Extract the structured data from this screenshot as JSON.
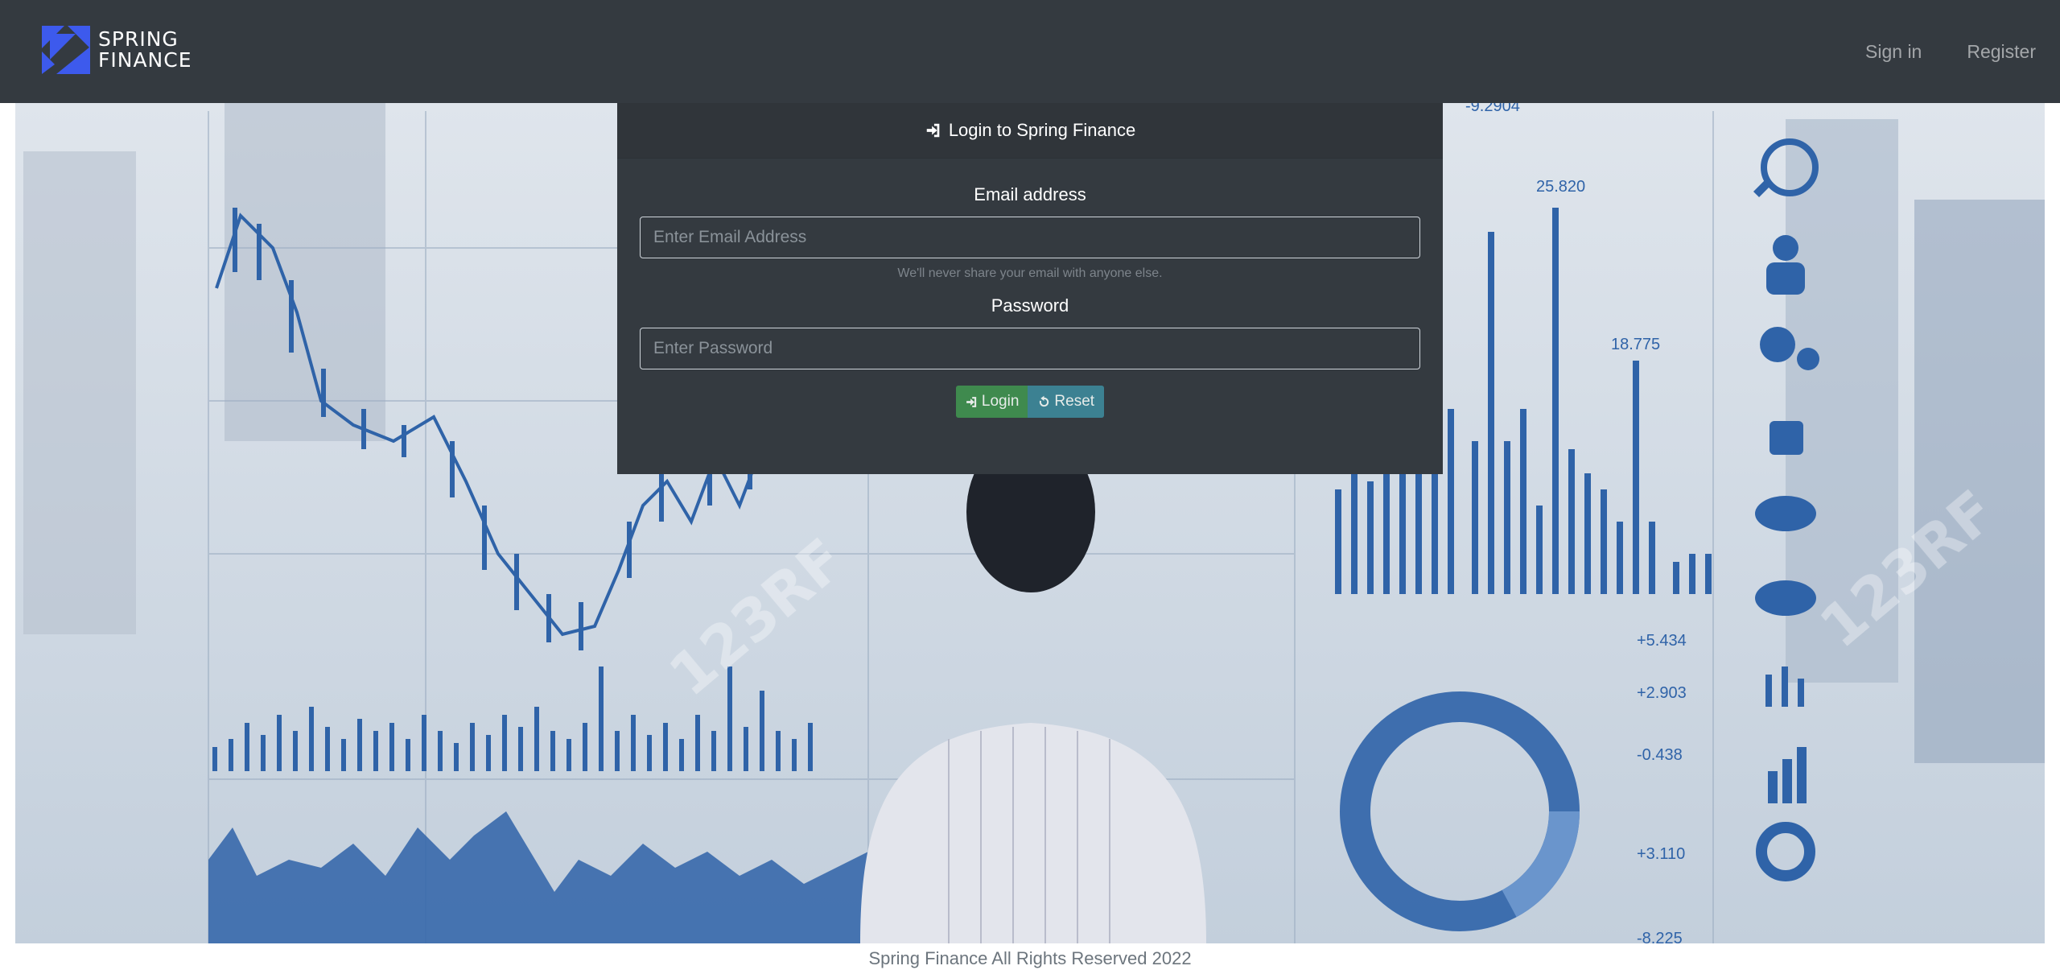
{
  "brand": {
    "line1": "SPRING",
    "line2": "FINANCE",
    "logo_icon": "spring-finance-logo-icon",
    "logo_color": "#3d5aed"
  },
  "nav": {
    "signin": "Sign in",
    "register": "Register"
  },
  "hero": {
    "watermark": "123RF",
    "chart_labels": [
      "-9.2904",
      "25.820",
      "18.775",
      "+5.434",
      "+2.903",
      "-0.438",
      "+3.110",
      "-8.225"
    ]
  },
  "login": {
    "header": "Login to Spring Finance",
    "header_icon": "sign-in-icon",
    "email_label": "Email address",
    "email_placeholder": "Enter Email Address",
    "email_value": "",
    "email_help": "We'll never share your email with anyone else.",
    "password_label": "Password",
    "password_placeholder": "Enter Password",
    "password_value": "",
    "login_button": "Login",
    "login_icon": "sign-in-icon",
    "reset_button": "Reset",
    "reset_icon": "undo-icon"
  },
  "footer": {
    "text": "Spring Finance All Rights Reserved 2022"
  },
  "colors": {
    "navbar": "#343a40",
    "login_button": "#3f8a4e",
    "reset_button": "#3c8192",
    "chart_blue": "#2f63a8"
  }
}
